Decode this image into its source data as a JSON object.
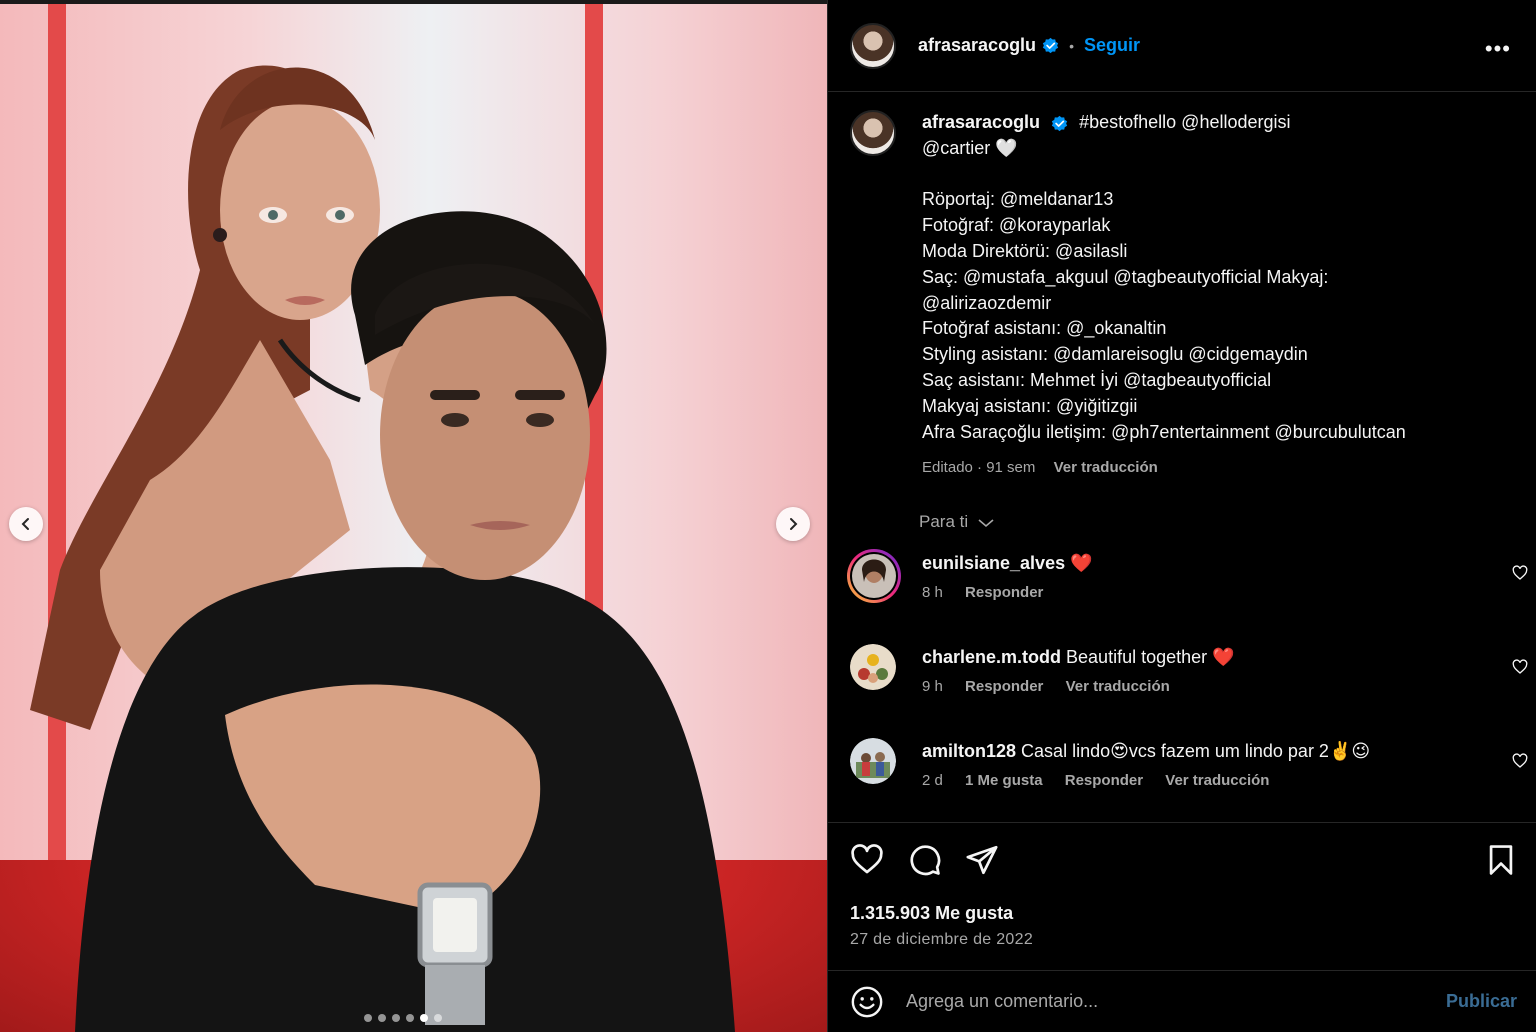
{
  "post": {
    "username": "afrasaracoglu",
    "follow_label": "Seguir",
    "separator": "•",
    "more_label": "•••",
    "carousel": {
      "total": 6,
      "active_index": 4
    }
  },
  "caption": {
    "username": "afrasaracoglu",
    "lines": [
      "#bestofhello @hellodergisi",
      "@cartier 🤍",
      "",
      "Röportaj: @meldanar13",
      "Fotoğraf: @korayparlak",
      "Moda Direktörü: @asilasli",
      "Saç: @mustafa_akguul @tagbeautyofficial Makyaj:",
      "@alirizaozdemir",
      "Fotoğraf asistanı: @_okanaltin",
      "Styling asistanı: @damlareisoglu @cidgemaydin",
      "Saç asistanı: Mehmet İyi @tagbeautyofficial",
      "Makyaj asistanı: @yiğitizgii",
      "Afra Saraçoğlu iletişim: @ph7entertainment @burcubulutcan"
    ],
    "meta": "Editado · 91 sem",
    "translate": "Ver traducción"
  },
  "filter_label": "Para ti",
  "comments": [
    {
      "user": "eunilsiane_alves",
      "text": " ❤️",
      "time": "8 h",
      "likes": "",
      "reply": "Responder",
      "translate": ""
    },
    {
      "user": "charlene.m.todd",
      "text": " Beautiful together ❤️",
      "time": "9 h",
      "likes": "",
      "reply": "Responder",
      "translate": "Ver traducción"
    },
    {
      "user": "amilton128",
      "text": " Casal lindo😍vcs fazem um lindo par 2✌️😉",
      "time": "2 d",
      "likes": "1 Me gusta",
      "reply": "Responder",
      "translate": "Ver traducción"
    }
  ],
  "stats": {
    "likes": "1.315.903 Me gusta",
    "date": "27 de diciembre de 2022"
  },
  "comment_box": {
    "placeholder": "Agrega un comentario...",
    "publish": "Publicar"
  },
  "colors": {
    "background": "#000000",
    "accent": "#0095f6",
    "muted": "#a8a8a8",
    "divider": "#262626",
    "backdrop_red": "#e34a4a"
  }
}
